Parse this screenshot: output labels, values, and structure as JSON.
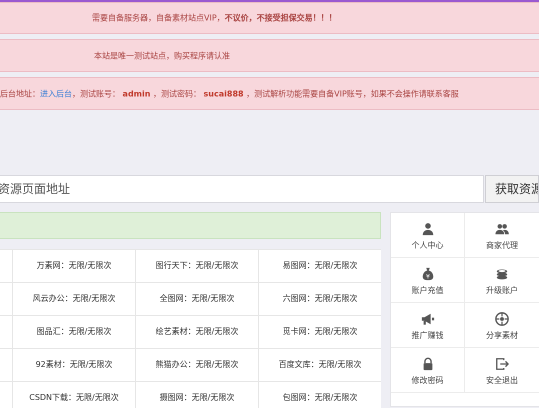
{
  "alerts": {
    "line1_prefix": "需要自备服务器，自备素材站点VIP，",
    "line1_strong": "不议价，不接受担保交易！！！",
    "line2": "本站是唯一测试站点，购买程序请认准",
    "line3_label": "后台地址：",
    "line3_link": "进入后台",
    "line3_user_label": "，测试账号：",
    "line3_user": "admin",
    "line3_pass_label": "，测试密码：",
    "line3_pass": "sucai888",
    "line3_suffix": "，测试解析功能需要自备VIP账号，如果不会操作请联系客服"
  },
  "search": {
    "placeholder": "资源页面地址",
    "button": "获取资源"
  },
  "quota_rows": [
    [
      "万素网：无限/无限次",
      "图行天下：无限/无限次",
      "易图网：无限/无限次"
    ],
    [
      "风云办公：无限/无限次",
      "全图网：无限/无限次",
      "六图网：无限/无限次"
    ],
    [
      "图品汇：无限/无限次",
      "绘艺素材：无限/无限次",
      "觅卡网：无限/无限次"
    ],
    [
      "92素材：无限/无限次",
      "熊猫办公：无限/无限次",
      "百度文库：无限/无限次"
    ],
    [
      "CSDN下载：无限/无限次",
      "摄图网：无限/无限次",
      "包图网：无限/无限次"
    ]
  ],
  "menu": [
    {
      "label": "个人中心",
      "icon": "user-icon"
    },
    {
      "label": "商家代理",
      "icon": "users-icon"
    },
    {
      "label": "账户充值",
      "icon": "money-bag-icon"
    },
    {
      "label": "升级账户",
      "icon": "coins-icon"
    },
    {
      "label": "推广赚钱",
      "icon": "megaphone-icon"
    },
    {
      "label": "分享素材",
      "icon": "share-icon"
    },
    {
      "label": "修改密码",
      "icon": "lock-icon"
    },
    {
      "label": "安全退出",
      "icon": "logout-icon"
    }
  ],
  "colors": {
    "alert_bg": "#f8d7dc",
    "alert_text": "#a94442",
    "success_bg": "#dff0d8",
    "link": "#3a7fd5",
    "accent_red": "#c0392b"
  }
}
